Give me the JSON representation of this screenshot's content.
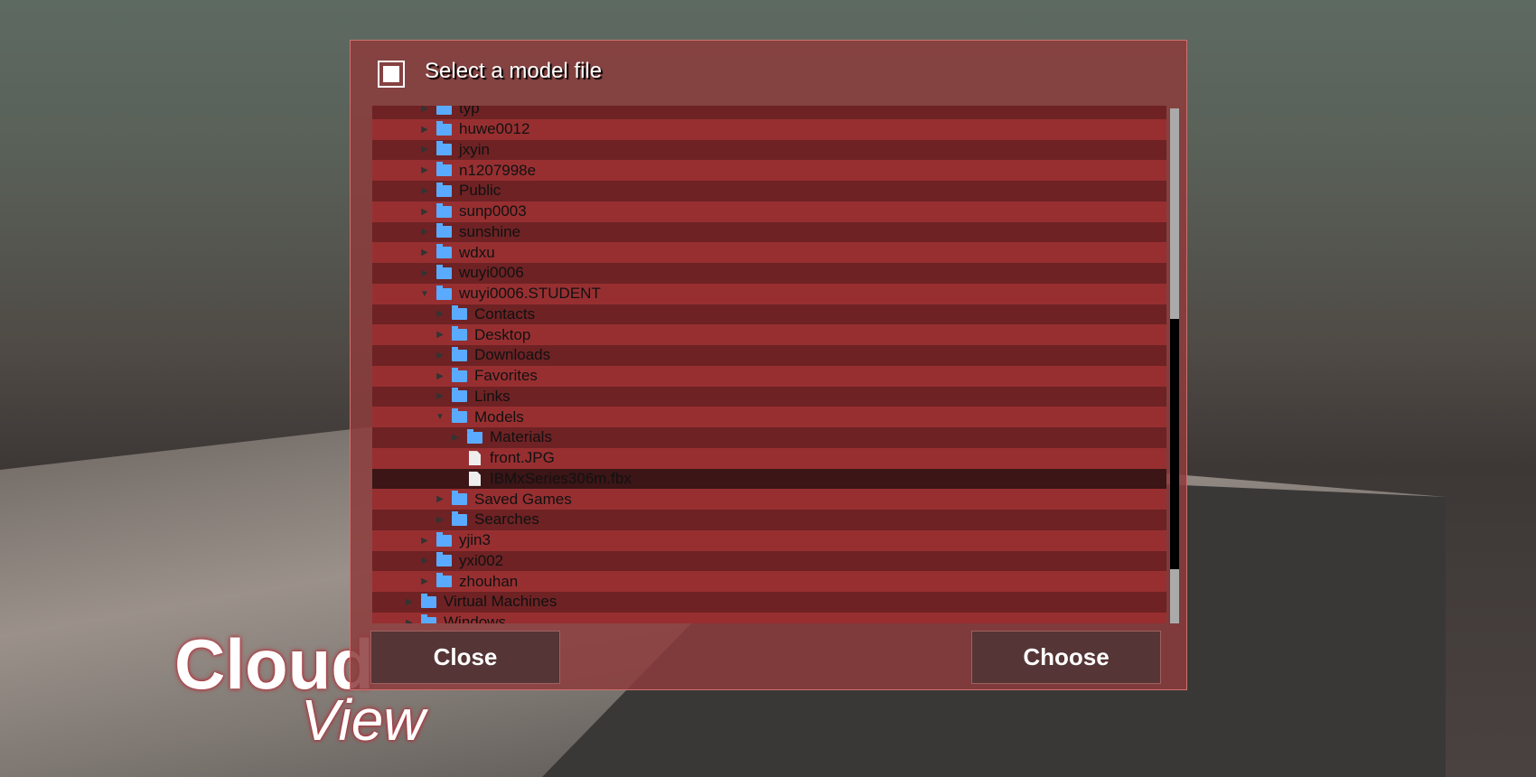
{
  "dialog": {
    "title": "Select a model file",
    "close_label": "Close",
    "choose_label": "Choose"
  },
  "logo": {
    "line1": "Cloud",
    "line2": "View"
  },
  "tree": [
    {
      "label": "typ",
      "level": 1,
      "type": "folder",
      "expanded": false
    },
    {
      "label": "huwe0012",
      "level": 1,
      "type": "folder",
      "expanded": false
    },
    {
      "label": "jxyin",
      "level": 1,
      "type": "folder",
      "expanded": false
    },
    {
      "label": "n1207998e",
      "level": 1,
      "type": "folder",
      "expanded": false
    },
    {
      "label": "Public",
      "level": 1,
      "type": "folder",
      "expanded": false
    },
    {
      "label": "sunp0003",
      "level": 1,
      "type": "folder",
      "expanded": false
    },
    {
      "label": "sunshine",
      "level": 1,
      "type": "folder",
      "expanded": false
    },
    {
      "label": "wdxu",
      "level": 1,
      "type": "folder",
      "expanded": false
    },
    {
      "label": "wuyi0006",
      "level": 1,
      "type": "folder",
      "expanded": false
    },
    {
      "label": "wuyi0006.STUDENT",
      "level": 1,
      "type": "folder",
      "expanded": true
    },
    {
      "label": "Contacts",
      "level": 2,
      "type": "folder",
      "expanded": false
    },
    {
      "label": "Desktop",
      "level": 2,
      "type": "folder",
      "expanded": false
    },
    {
      "label": "Downloads",
      "level": 2,
      "type": "folder",
      "expanded": false
    },
    {
      "label": "Favorites",
      "level": 2,
      "type": "folder",
      "expanded": false
    },
    {
      "label": "Links",
      "level": 2,
      "type": "folder",
      "expanded": false
    },
    {
      "label": "Models",
      "level": 2,
      "type": "folder",
      "expanded": true
    },
    {
      "label": "Materials",
      "level": 3,
      "type": "folder",
      "expanded": false
    },
    {
      "label": "front.JPG",
      "level": 3,
      "type": "file"
    },
    {
      "label": "IBMxSeries306m.fbx",
      "level": 3,
      "type": "file",
      "selected": true
    },
    {
      "label": "Saved Games",
      "level": 2,
      "type": "folder",
      "expanded": false
    },
    {
      "label": "Searches",
      "level": 2,
      "type": "folder",
      "expanded": false
    },
    {
      "label": "yjin3",
      "level": 1,
      "type": "folder",
      "expanded": false
    },
    {
      "label": "yxi002",
      "level": 1,
      "type": "folder",
      "expanded": false
    },
    {
      "label": "zhouhan",
      "level": 1,
      "type": "folder",
      "expanded": false
    },
    {
      "label": "Virtual Machines",
      "level": 0,
      "type": "folder",
      "expanded": false
    },
    {
      "label": "Windows",
      "level": 0,
      "type": "folder",
      "expanded": false
    }
  ]
}
